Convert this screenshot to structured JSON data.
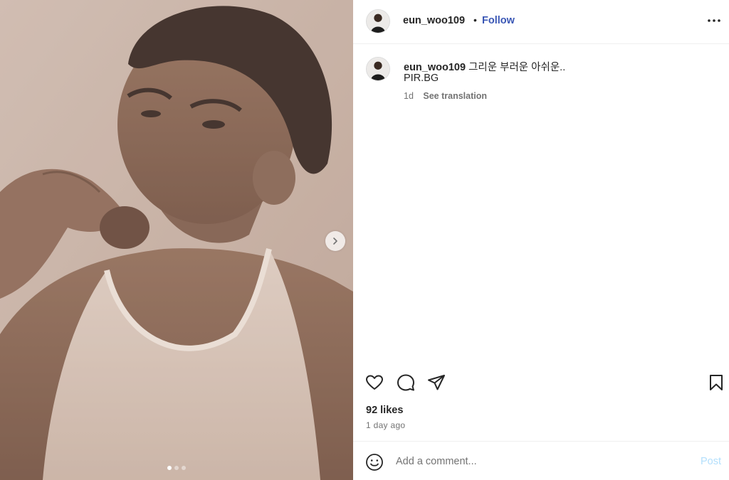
{
  "post": {
    "username": "eun_woo109",
    "separator": "•",
    "follow_label": "Follow",
    "more_icon": "more-horizontal-icon"
  },
  "caption": {
    "username": "eun_woo109",
    "text": "그리운 부러운 아쉬운..",
    "text_line2": "PIR.BG",
    "time": "1d",
    "see_translation": "See translation"
  },
  "media": {
    "carousel_count": 3,
    "active_index": 0,
    "next_icon": "chevron-right-icon"
  },
  "actions": {
    "icons": [
      "heart-icon",
      "comment-icon",
      "share-icon",
      "bookmark-icon"
    ]
  },
  "stats": {
    "likes": "92 likes",
    "date": "1 day ago"
  },
  "comment": {
    "placeholder": "Add a comment...",
    "post_label": "Post",
    "emoji_icon": "emoji-icon"
  },
  "colors": {
    "follow": "#3a57b5",
    "post_disabled": "#b2dffc",
    "text": "#262626",
    "muted": "#737373"
  }
}
